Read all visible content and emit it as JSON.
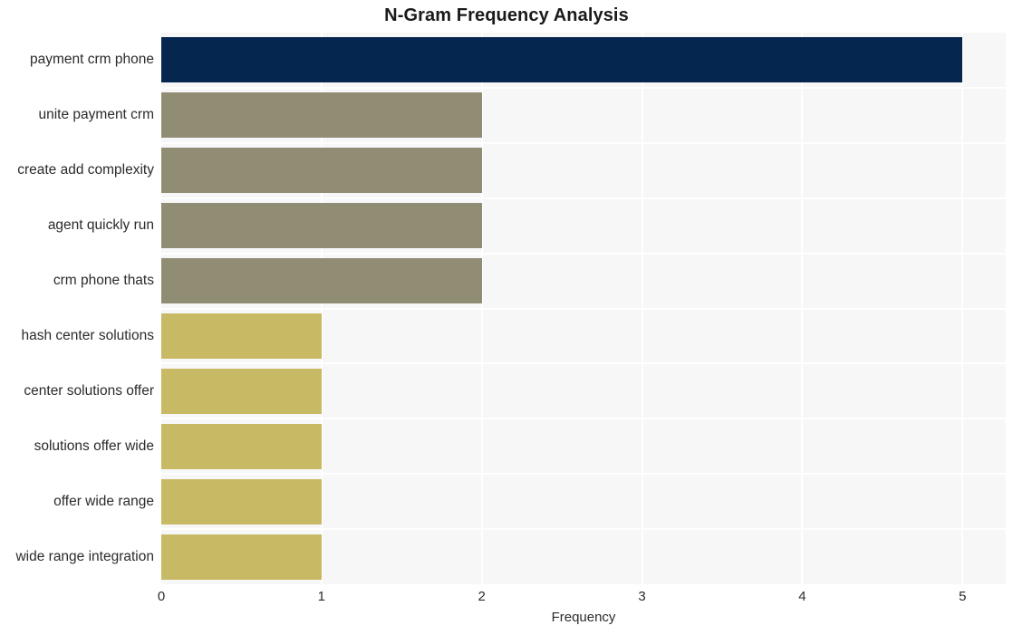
{
  "chart_data": {
    "type": "bar",
    "orientation": "horizontal",
    "title": "N-Gram Frequency Analysis",
    "xlabel": "Frequency",
    "ylabel": "",
    "categories": [
      "payment crm phone",
      "unite payment crm",
      "create add complexity",
      "agent quickly run",
      "crm phone thats",
      "hash center solutions",
      "center solutions offer",
      "solutions offer wide",
      "offer wide range",
      "wide range integration"
    ],
    "values": [
      5,
      2,
      2,
      2,
      2,
      1,
      1,
      1,
      1,
      1
    ],
    "bar_colors": [
      "#04264f",
      "#918c74",
      "#918c74",
      "#918c74",
      "#918c74",
      "#c8b964",
      "#c8b964",
      "#c8b964",
      "#c8b964",
      "#c8b964"
    ],
    "xlim": [
      0,
      5.27
    ],
    "xticks": [
      0,
      1,
      2,
      3,
      4,
      5
    ],
    "xtick_labels": [
      "0",
      "1",
      "2",
      "3",
      "4",
      "5"
    ],
    "grid": true,
    "grid_color": "#ffffff",
    "legend": "none",
    "plot_background": "#f7f7f8",
    "figure_background": "#ffffff",
    "title_color": "#1a1a1a",
    "tick_color": "#2b2b2b"
  }
}
